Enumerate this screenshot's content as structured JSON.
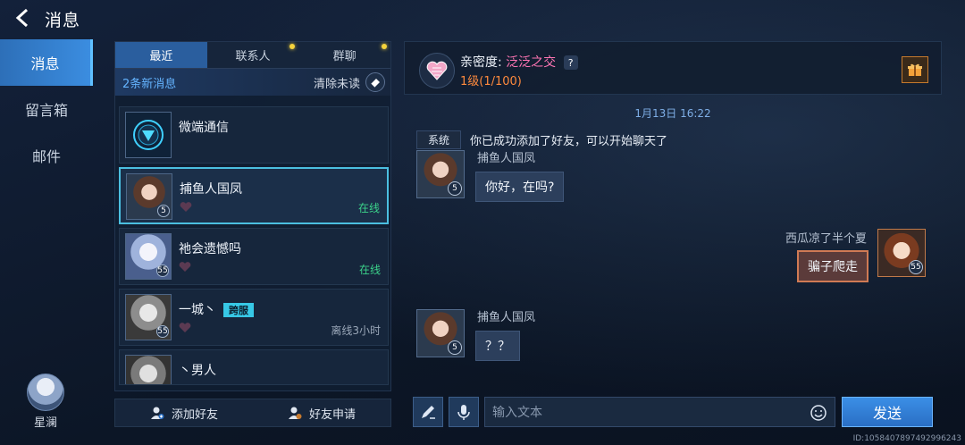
{
  "header": {
    "title": "消息"
  },
  "leftnav": {
    "items": [
      "消息",
      "留言箱",
      "邮件"
    ],
    "active": 0
  },
  "player": {
    "name": "星澜"
  },
  "tabs": [
    {
      "label": "最近",
      "active": true,
      "dot": false
    },
    {
      "label": "联系人",
      "active": false,
      "dot": true
    },
    {
      "label": "群聊",
      "active": false,
      "dot": true
    }
  ],
  "newbar": {
    "count_label": "2条新消息",
    "clear_label": "清除未读"
  },
  "conversations": [
    {
      "name": "微端通信",
      "status": "",
      "level": "",
      "tag": ""
    },
    {
      "name": "捕鱼人国凤",
      "status": "在线",
      "level": "5",
      "tag": ""
    },
    {
      "name": "祂会遗憾吗",
      "status": "在线",
      "level": "55",
      "tag": ""
    },
    {
      "name": "一城丶",
      "status": "离线3小时",
      "level": "55",
      "tag": "跨服"
    },
    {
      "name": "丶男人",
      "status": "",
      "level": "",
      "tag": ""
    }
  ],
  "bottombar": {
    "add_friend": "添加好友",
    "friend_request": "好友申请"
  },
  "intimacy": {
    "label": "亲密度:",
    "value": "泛泛之交",
    "help": "?",
    "level": "1级(1/100)"
  },
  "chat": {
    "time": "1月13日 16:22",
    "system_tag": "系统",
    "system_msg": "你已成功添加了好友，可以开始聊天了",
    "messages": [
      {
        "sender": "捕鱼人国凤",
        "text": "你好，在吗?",
        "level": "5",
        "mine": false
      },
      {
        "sender": "西瓜凉了半个夏",
        "text": "骗子爬走",
        "level": "55",
        "mine": true
      },
      {
        "sender": "捕鱼人国凤",
        "text": "？？",
        "level": "5",
        "mine": false
      }
    ]
  },
  "input": {
    "placeholder": "输入文本",
    "send": "发送"
  },
  "uid": "ID:1058407897492996243",
  "colors": {
    "accent": "#3b8de0",
    "online": "#3bd28a",
    "intimacy": "#ff75b4",
    "level": "#ff8a3d"
  }
}
